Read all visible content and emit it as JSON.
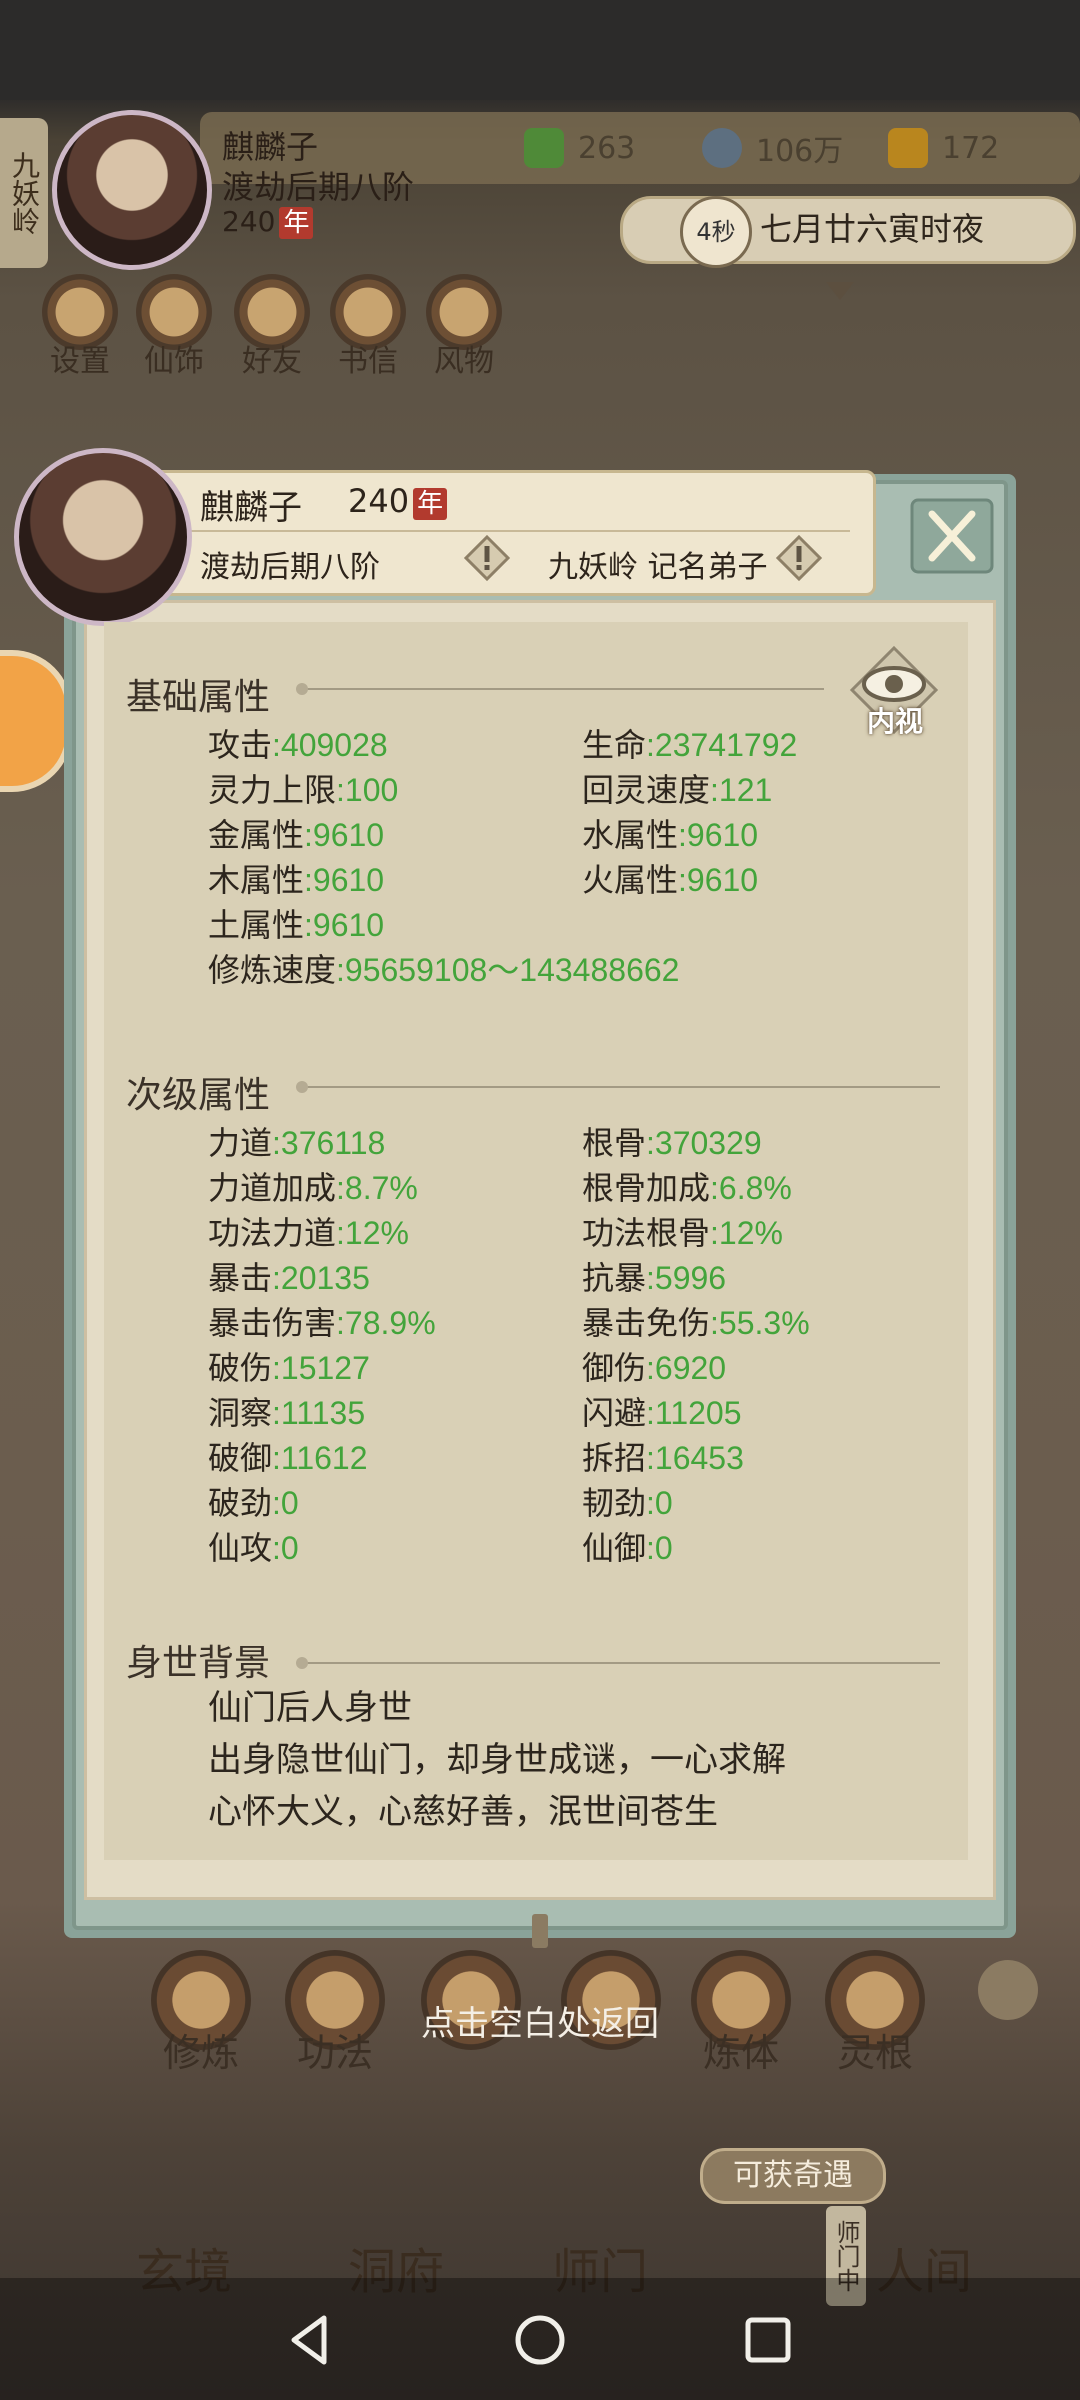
{
  "hud": {
    "region": "九妖岭",
    "name": "麒麟子",
    "rank": "渡劫后期八阶",
    "age": "240",
    "age_unit": "年",
    "resources": [
      {
        "icon": "jade-leaf-icon",
        "value": "263"
      },
      {
        "icon": "coin-icon",
        "value": "106万"
      },
      {
        "icon": "ingot-icon",
        "value": "172"
      }
    ],
    "timer_badge": "4秒",
    "time_text": "七月廿六寅时夜"
  },
  "top_menu": [
    "设置",
    "仙饰",
    "好友",
    "书信",
    "风物"
  ],
  "modal": {
    "name": "麒麟子",
    "age": "240",
    "age_unit": "年",
    "rank": "渡劫后期八阶",
    "sect": "九妖岭 记名弟子",
    "inner_view_label": "内视",
    "basic": {
      "title": "基础属性",
      "left": [
        {
          "k": "攻击",
          "v": "409028"
        },
        {
          "k": "灵力上限",
          "v": "100"
        },
        {
          "k": "金属性",
          "v": "9610"
        },
        {
          "k": "木属性",
          "v": "9610"
        },
        {
          "k": "土属性",
          "v": "9610"
        },
        {
          "k": "修炼速度",
          "v": "95659108～143488662"
        }
      ],
      "right": [
        {
          "k": "生命",
          "v": "23741792"
        },
        {
          "k": "回灵速度",
          "v": "121"
        },
        {
          "k": "水属性",
          "v": "9610"
        },
        {
          "k": "火属性",
          "v": "9610"
        }
      ]
    },
    "secondary": {
      "title": "次级属性",
      "left": [
        {
          "k": "力道",
          "v": "376118"
        },
        {
          "k": "力道加成",
          "v": "8.7%"
        },
        {
          "k": "功法力道",
          "v": "12%"
        },
        {
          "k": "暴击",
          "v": "20135"
        },
        {
          "k": "暴击伤害",
          "v": "78.9%"
        },
        {
          "k": "破伤",
          "v": "15127"
        },
        {
          "k": "洞察",
          "v": "11135"
        },
        {
          "k": "破御",
          "v": "11612"
        },
        {
          "k": "破劲",
          "v": "0"
        },
        {
          "k": "仙攻",
          "v": "0"
        }
      ],
      "right": [
        {
          "k": "根骨",
          "v": "370329"
        },
        {
          "k": "根骨加成",
          "v": "6.8%"
        },
        {
          "k": "功法根骨",
          "v": "12%"
        },
        {
          "k": "抗暴",
          "v": "5996"
        },
        {
          "k": "暴击免伤",
          "v": "55.3%"
        },
        {
          "k": "御伤",
          "v": "6920"
        },
        {
          "k": "闪避",
          "v": "11205"
        },
        {
          "k": "拆招",
          "v": "16453"
        },
        {
          "k": "韧劲",
          "v": "0"
        },
        {
          "k": "仙御",
          "v": "0"
        }
      ]
    },
    "background": {
      "title": "身世背景",
      "lines": [
        "仙门后人身世",
        "出身隐世仙门，却身世成谜，一心求解",
        "心怀大义，心慈好善，泯世间苍生"
      ]
    }
  },
  "return_hint": "点击空白处返回",
  "bottom_menu": [
    "修炼",
    "功法",
    "",
    "",
    "炼体",
    "灵根"
  ],
  "qiyu": "可获奇遇",
  "shimen_tag": "师门中",
  "main_nav": [
    "玄境",
    "洞府",
    "师门",
    "人间"
  ],
  "colors": {
    "stat_value": "#43a43b",
    "nian_badge": "#b23a2e",
    "modal_frame": "#a9bdb2",
    "paper": "#e4dcc6"
  }
}
